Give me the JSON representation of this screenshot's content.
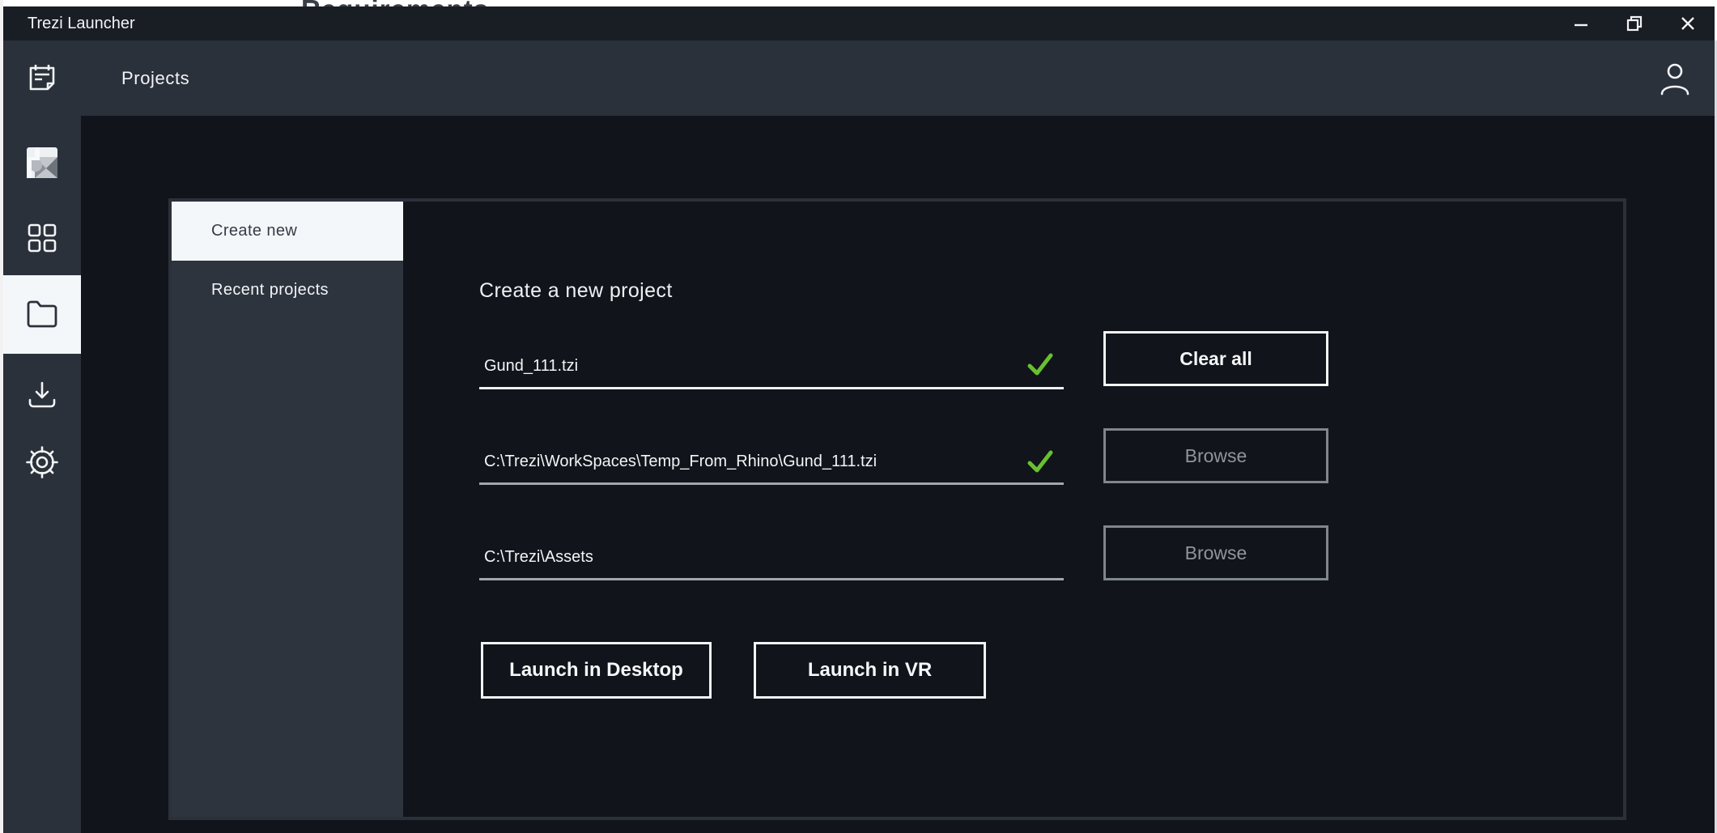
{
  "page_behind": {
    "clipped_text": "Requirements"
  },
  "window": {
    "title": "Trezi Launcher"
  },
  "titlebar": {
    "controls": [
      {
        "name": "minimize",
        "icon": "minimize-icon"
      },
      {
        "name": "restore",
        "icon": "restore-icon"
      },
      {
        "name": "close",
        "icon": "close-icon"
      }
    ]
  },
  "header": {
    "title": "Projects",
    "user_icon": "user-icon"
  },
  "sidebar": {
    "items": [
      {
        "name": "notes",
        "icon": "notepad-icon",
        "active": false
      },
      {
        "name": "rhino",
        "icon": "rhino-logo-icon",
        "active": false
      },
      {
        "name": "apps",
        "icon": "grid-icon",
        "active": false
      },
      {
        "name": "projects",
        "icon": "folder-icon",
        "active": true
      },
      {
        "name": "downloads",
        "icon": "download-icon",
        "active": false
      },
      {
        "name": "settings",
        "icon": "gear-icon",
        "active": false
      }
    ]
  },
  "tabs": [
    {
      "label": "Create new",
      "active": true
    },
    {
      "label": "Recent projects",
      "active": false
    }
  ],
  "form": {
    "heading": "Create a new project",
    "fields": [
      {
        "value": "Gund_111.tzi",
        "valid": true,
        "action": "Clear all",
        "action_style": "primary"
      },
      {
        "value": "C:\\Trezi\\WorkSpaces\\Temp_From_Rhino\\Gund_111.tzi",
        "valid": true,
        "action": "Browse",
        "action_style": "muted"
      },
      {
        "value": "C:\\Trezi\\Assets",
        "valid": false,
        "action": "Browse",
        "action_style": "muted"
      }
    ],
    "launch": [
      {
        "label": "Launch in Desktop"
      },
      {
        "label": "Launch in VR"
      }
    ]
  },
  "colors": {
    "accent_green": "#68c02f",
    "titlebar": "#191d24",
    "panel": "#2b313b",
    "tab_panel": "#2e343e",
    "background": "#11141a",
    "active_item": "#f4f7fa"
  }
}
